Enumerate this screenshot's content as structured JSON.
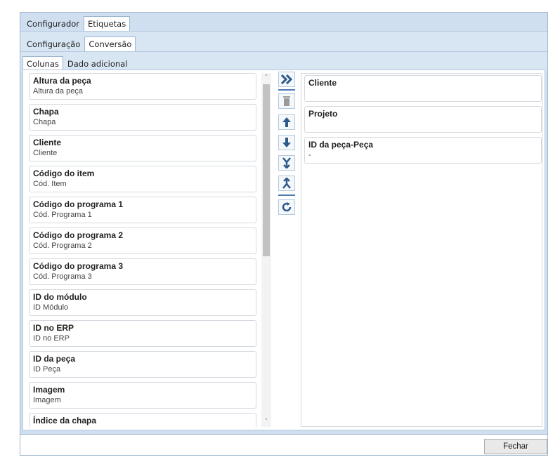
{
  "tabs_level1": [
    "Configurador",
    "Etiquetas"
  ],
  "tabs_level2": [
    "Configuração",
    "Conversão"
  ],
  "tabs_level3": [
    "Colunas",
    "Dado adicional"
  ],
  "available_columns": [
    {
      "title": "Altura da peça",
      "subtitle": "Altura da peça"
    },
    {
      "title": "Chapa",
      "subtitle": "Chapa"
    },
    {
      "title": "Cliente",
      "subtitle": "Cliente"
    },
    {
      "title": "Código do item",
      "subtitle": "Cód. Item"
    },
    {
      "title": "Código do programa 1",
      "subtitle": "Cód. Programa 1"
    },
    {
      "title": "Código do programa 2",
      "subtitle": "Cód. Programa 2"
    },
    {
      "title": "Código do programa 3",
      "subtitle": "Cód. Programa 3"
    },
    {
      "title": "ID do módulo",
      "subtitle": "ID Módulo"
    },
    {
      "title": "ID no ERP",
      "subtitle": "ID no ERP"
    },
    {
      "title": "ID da peça",
      "subtitle": "ID Peça"
    },
    {
      "title": "Imagem",
      "subtitle": "Imagem"
    },
    {
      "title": "Índice da chapa",
      "subtitle": ""
    }
  ],
  "selected_columns": [
    {
      "title": "Cliente",
      "subtitle": ""
    },
    {
      "title": "Projeto",
      "subtitle": ""
    },
    {
      "title": "ID da peça-Peça",
      "subtitle": "-"
    }
  ],
  "footer": {
    "close_label": "Fechar"
  },
  "colors": {
    "accent": "#4a7ab0",
    "tab_band": "#d8e6f4",
    "frame_bg": "#cfdff0"
  }
}
